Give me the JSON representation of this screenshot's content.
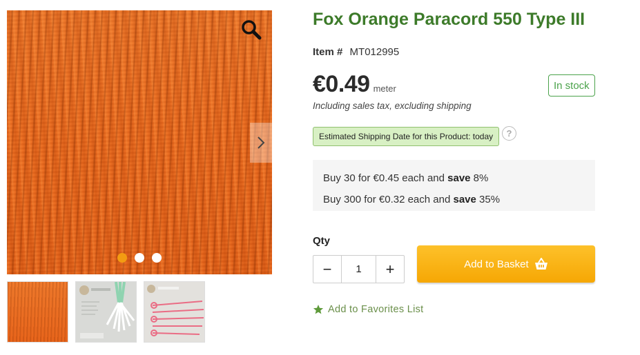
{
  "product": {
    "title": "Fox Orange Paracord 550 Type III",
    "item_label": "Item #",
    "item_number": "MT012995",
    "price": "€0.49",
    "unit": "meter",
    "tax_note": "Including sales tax, excluding shipping",
    "stock_status": "In stock",
    "shipping_estimate": "Estimated Shipping Date for this Product: today",
    "help_icon": "question-circle-icon"
  },
  "tiers": [
    {
      "prefix": "Buy 30 for €0.45 each and ",
      "save_word": "save",
      "suffix": " 8%"
    },
    {
      "prefix": "Buy 300 for €0.32 each and ",
      "save_word": "save",
      "suffix": " 35%"
    }
  ],
  "purchase": {
    "qty_label": "Qty",
    "qty_value": "1",
    "minus_label": "−",
    "plus_label": "+",
    "add_to_basket_label": "Add to Basket",
    "favorites_label": "Add to Favorites List"
  },
  "gallery": {
    "zoom_icon": "magnifier-icon",
    "next_icon": "chevron-right-icon",
    "dots_count": 3,
    "active_dot": 0
  },
  "colors": {
    "title_green": "#3d7b2a",
    "stock_green": "#4aa24a",
    "basket_orange": "#f6a704",
    "dot_active": "#f39c12"
  }
}
